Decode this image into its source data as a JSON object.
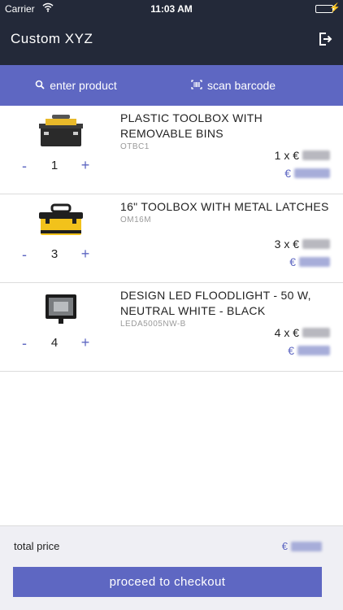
{
  "status_bar": {
    "carrier": "Carrier",
    "time": "11:03 AM",
    "battery_level": 1.0
  },
  "header": {
    "title": "Custom XYZ",
    "logout_icon": "logout-icon"
  },
  "actions": {
    "enter_product_label": "enter product",
    "enter_product_icon": "search-icon",
    "scan_barcode_label": "scan barcode",
    "scan_barcode_icon": "barcode-icon"
  },
  "items": [
    {
      "name": "PLASTIC TOOLBOX WITH REMOVABLE BINS",
      "sku": "OTBC1",
      "quantity": "1",
      "unit_prefix": "1 x €",
      "total_prefix": "€",
      "image": "toolbox-black-image"
    },
    {
      "name": "16\" TOOLBOX WITH METAL LATCHES",
      "sku": "OM16M",
      "quantity": "3",
      "unit_prefix": "3 x €",
      "total_prefix": "€",
      "image": "toolbox-yellow-image"
    },
    {
      "name": "DESIGN LED FLOODLIGHT - 50 W, NEUTRAL WHITE - BLACK",
      "sku": "LEDA5005NW-B",
      "quantity": "4",
      "unit_prefix": "4 x €",
      "total_prefix": "€",
      "image": "floodlight-image"
    }
  ],
  "controls": {
    "minus": "-",
    "plus": "+"
  },
  "footer": {
    "total_label": "total price",
    "total_prefix": "€",
    "checkout_label": "proceed to checkout"
  },
  "colors": {
    "header_bg": "#232939",
    "accent": "#5e67c2",
    "footer_bg": "#efeff4"
  }
}
